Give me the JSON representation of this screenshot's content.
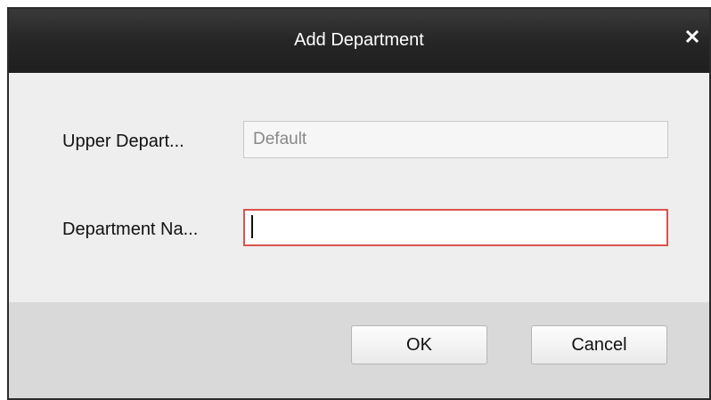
{
  "dialog": {
    "title": "Add Department",
    "close_icon": "close-icon"
  },
  "form": {
    "upper_department_label": "Upper Depart...",
    "upper_department_value": "Default",
    "department_name_label": "Department Na...",
    "department_name_value": ""
  },
  "buttons": {
    "ok_label": "OK",
    "cancel_label": "Cancel"
  },
  "colors": {
    "title_bar": "#262626",
    "active_field_border": "#d9534f"
  }
}
